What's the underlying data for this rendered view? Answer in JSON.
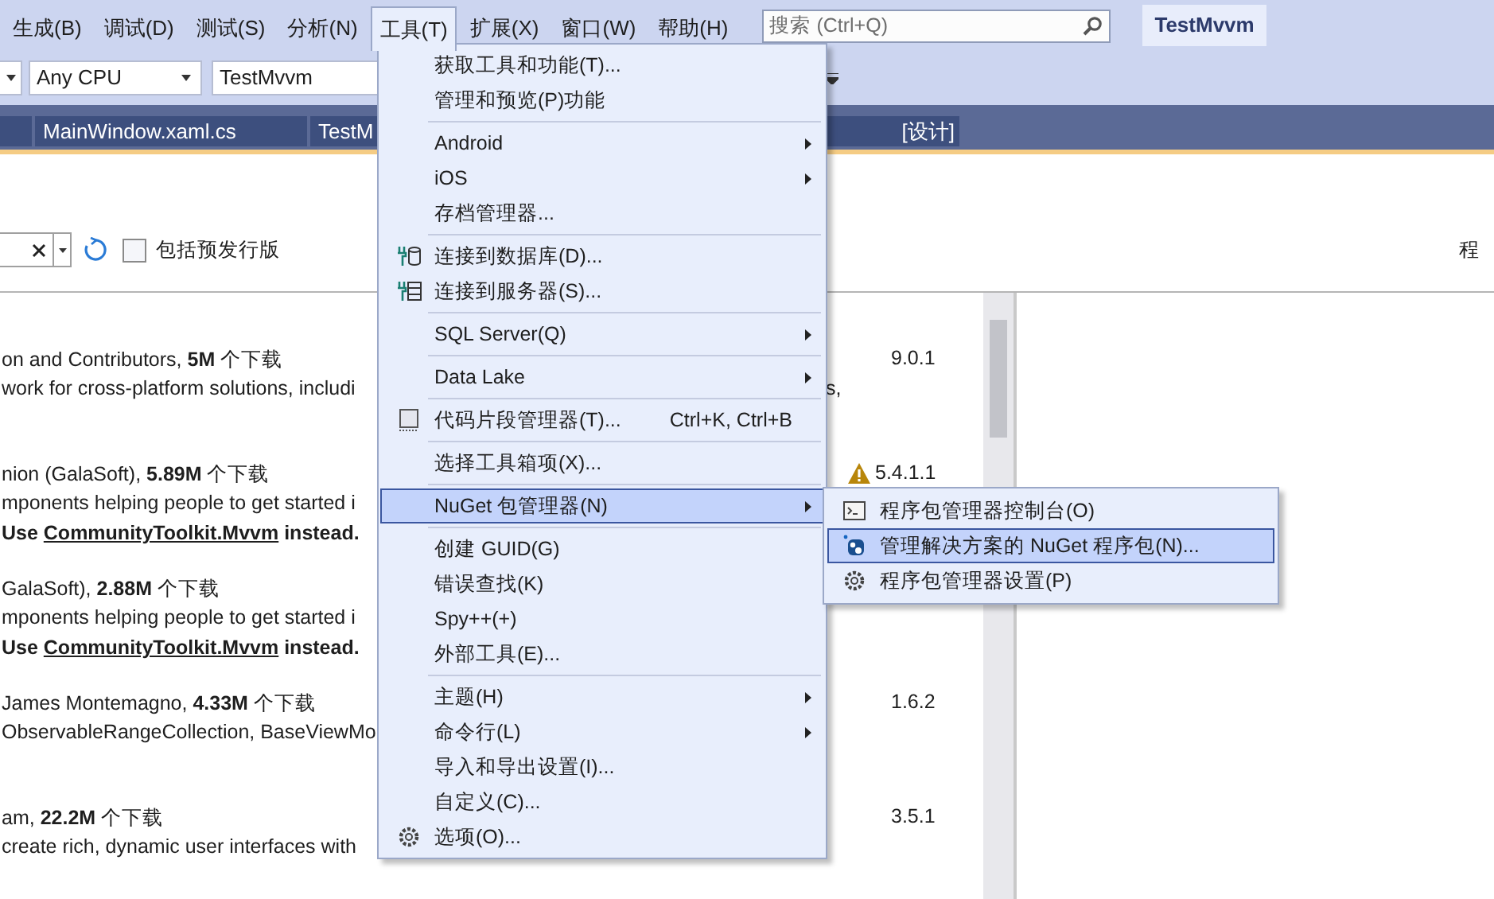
{
  "menu_bar": [
    {
      "label": "生成(B)",
      "selected": false
    },
    {
      "label": "调试(D)",
      "selected": false
    },
    {
      "label": "测试(S)",
      "selected": false
    },
    {
      "label": "分析(N)",
      "selected": false
    },
    {
      "label": "工具(T)",
      "selected": true
    },
    {
      "label": "扩展(X)",
      "selected": false
    },
    {
      "label": "窗口(W)",
      "selected": false
    },
    {
      "label": "帮助(H)",
      "selected": false
    }
  ],
  "search": {
    "placeholder": "搜索 (Ctrl+Q)"
  },
  "solution_title": "TestMvvm",
  "toolbar": {
    "platform": "Any CPU",
    "project": "TestMvvm"
  },
  "tabs": [
    {
      "label": "MainWindow.xaml.cs"
    },
    {
      "label_start": "TestM",
      "label_end": "[设计]"
    }
  ],
  "package_search": {
    "prerelease_label": "包括预发行版",
    "include_prerelease": false
  },
  "right_header": "程",
  "packages": [
    {
      "line_1": "on and Contributors, **5M** 个下载",
      "line_2": "work for cross-platform solutions, includi",
      "line_2_tail": "s,",
      "version": "9.0.1",
      "warning": false
    },
    {
      "line_1": "nion (GalaSoft), **5.89M** 个下载",
      "line_2": "mponents helping people to get started i",
      "notice_before": "Use",
      "notice_link": "CommunityToolkit.Mvvm",
      "notice_after": "instead.",
      "version": "5.4.1.1",
      "warning": true
    },
    {
      "line_1": "GalaSoft), **2.88M** 个下载",
      "line_2": "mponents helping people to get started i",
      "notice_before": "Use",
      "notice_link": "CommunityToolkit.Mvvm",
      "notice_after": "instead.",
      "warning": false
    },
    {
      "line_1": "James Montemagno, **4.33M** 个下载",
      "line_2": "ObservableRangeCollection, BaseViewMo",
      "version": "1.6.2",
      "warning": false
    },
    {
      "line_1": "am, **22.2M** 个下载",
      "line_2": "create rich, dynamic user interfaces with",
      "version": "3.5.1",
      "warning": false
    }
  ],
  "tools_menu": {
    "items": [
      {
        "kind": "item",
        "label": "获取工具和功能(T)...",
        "submenu": false,
        "selected": false
      },
      {
        "kind": "item",
        "label": "管理和预览(P)功能",
        "submenu": false,
        "selected": false
      },
      {
        "kind": "separator"
      },
      {
        "kind": "item",
        "label": "Android",
        "submenu": true,
        "selected": false
      },
      {
        "kind": "item",
        "label": "iOS",
        "submenu": true,
        "selected": false
      },
      {
        "kind": "item",
        "label": "存档管理器...",
        "submenu": false,
        "selected": false
      },
      {
        "kind": "separator"
      },
      {
        "kind": "item",
        "label": "连接到数据库(D)...",
        "submenu": false,
        "selected": false
      },
      {
        "kind": "item",
        "label": "连接到服务器(S)...",
        "submenu": false,
        "selected": false
      },
      {
        "kind": "separator"
      },
      {
        "kind": "item",
        "label": "SQL Server(Q)",
        "submenu": true,
        "selected": false
      },
      {
        "kind": "separator"
      },
      {
        "kind": "item",
        "label": "Data Lake",
        "submenu": true,
        "selected": false
      },
      {
        "kind": "separator"
      },
      {
        "kind": "item",
        "label": "代码片段管理器(T)...",
        "shortcut": "Ctrl+K, Ctrl+B",
        "submenu": false,
        "selected": false
      },
      {
        "kind": "separator"
      },
      {
        "kind": "item",
        "label": "选择工具箱项(X)...",
        "submenu": false,
        "selected": false
      },
      {
        "kind": "separator"
      },
      {
        "kind": "item",
        "label": "NuGet 包管理器(N)",
        "submenu": true,
        "selected": true
      },
      {
        "kind": "separator"
      },
      {
        "kind": "item",
        "label": "创建 GUID(G)",
        "submenu": false,
        "selected": false
      },
      {
        "kind": "item",
        "label": "错误查找(K)",
        "submenu": false,
        "selected": false
      },
      {
        "kind": "item",
        "label": "Spy++(+)",
        "submenu": false,
        "selected": false
      },
      {
        "kind": "item",
        "label": "外部工具(E)...",
        "submenu": false,
        "selected": false
      },
      {
        "kind": "separator"
      },
      {
        "kind": "item",
        "label": "主题(H)",
        "submenu": true,
        "selected": false
      },
      {
        "kind": "item",
        "label": "命令行(L)",
        "submenu": true,
        "selected": false
      },
      {
        "kind": "item",
        "label": "导入和导出设置(I)...",
        "submenu": false,
        "selected": false
      },
      {
        "kind": "item",
        "label": "自定义(C)...",
        "submenu": false,
        "selected": false
      },
      {
        "kind": "item",
        "label": "选项(O)...",
        "submenu": false,
        "selected": false
      }
    ]
  },
  "nuget_submenu": {
    "items": [
      {
        "label": "程序包管理器控制台(O)",
        "selected": false
      },
      {
        "label": "管理解决方案的 NuGet 程序包(N)...",
        "selected": true
      },
      {
        "label": "程序包管理器设置(P)",
        "selected": false
      }
    ]
  }
}
